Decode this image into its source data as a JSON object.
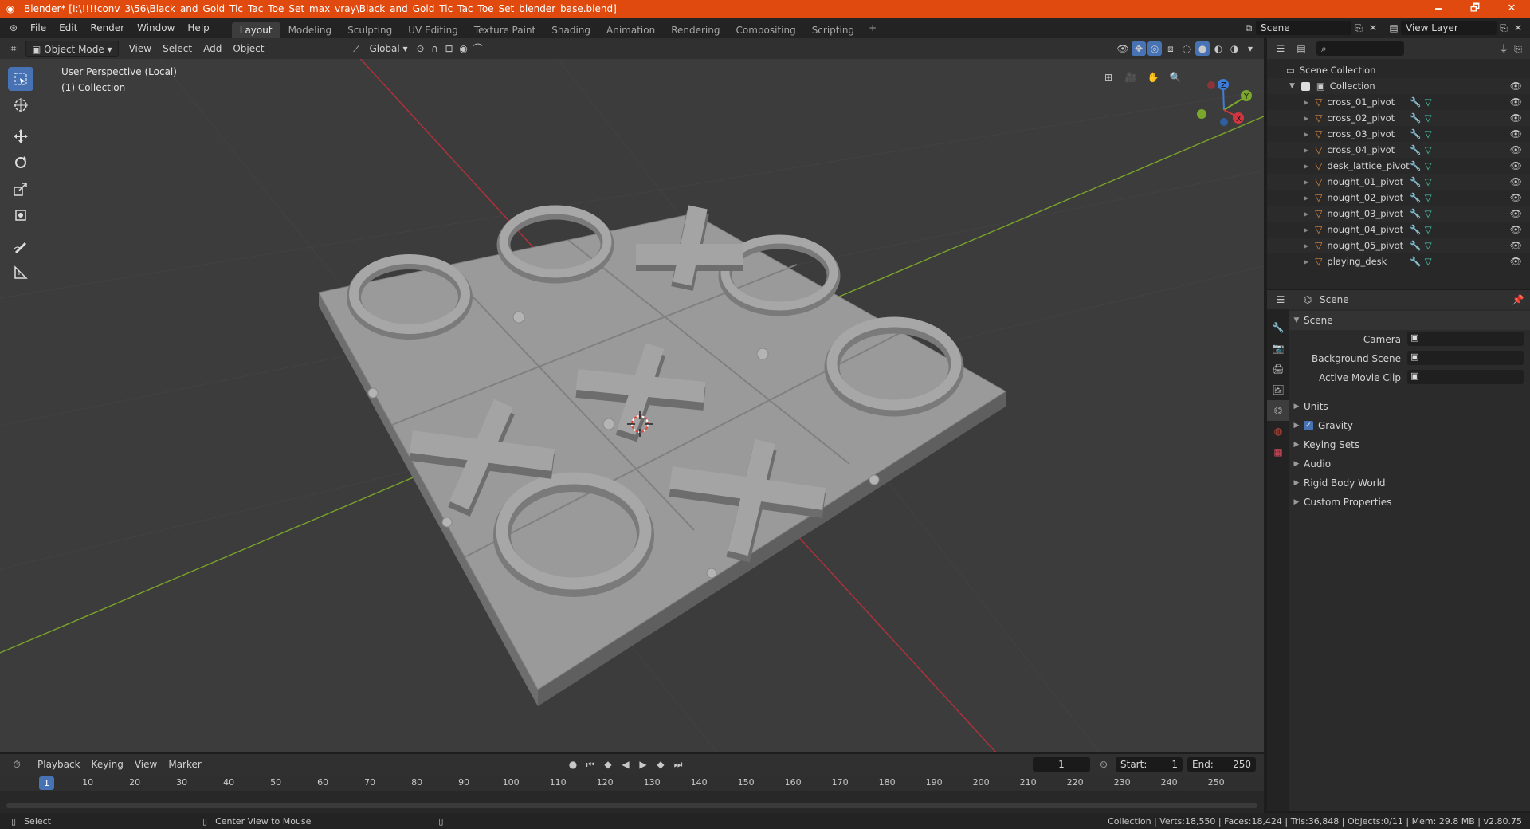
{
  "window": {
    "title": "Blender* [I:\\!!!!conv_3\\56\\Black_and_Gold_Tic_Tac_Toe_Set_max_vray\\Black_and_Gold_Tic_Tac_Toe_Set_blender_base.blend]",
    "minimize": "🗕",
    "maximize": "🗗",
    "close": "✕"
  },
  "menu": [
    "File",
    "Edit",
    "Render",
    "Window",
    "Help"
  ],
  "workspaces": [
    "Layout",
    "Modeling",
    "Sculpting",
    "UV Editing",
    "Texture Paint",
    "Shading",
    "Animation",
    "Rendering",
    "Compositing",
    "Scripting"
  ],
  "active_workspace": "Layout",
  "add_workspace": "+",
  "scene_field": "Scene",
  "view_layer_field": "View Layer",
  "viewport_header": {
    "mode": "Object Mode",
    "menus": [
      "View",
      "Select",
      "Add",
      "Object"
    ],
    "orientation": "Global"
  },
  "viewport": {
    "perspective_label": "User Perspective (Local)",
    "collection_label": "(1) Collection",
    "gizmo_axes": {
      "x": "X",
      "y": "Y",
      "z": "Z"
    },
    "colors": {
      "background": "#3c3c3c",
      "x_axis": "#b5303a",
      "y_axis": "#7aa32a",
      "board": "#9a9a9a"
    }
  },
  "outliner": {
    "root": "Scene Collection",
    "collection": "Collection",
    "items": [
      "cross_01_pivot",
      "cross_02_pivot",
      "cross_03_pivot",
      "cross_04_pivot",
      "desk_lattice_pivot",
      "nought_01_pivot",
      "nought_02_pivot",
      "nought_03_pivot",
      "nought_04_pivot",
      "nought_05_pivot",
      "playing_desk"
    ]
  },
  "properties": {
    "header": "Scene",
    "section": "Scene",
    "fields": [
      {
        "label": "Camera",
        "value": ""
      },
      {
        "label": "Background Scene",
        "value": ""
      },
      {
        "label": "Active Movie Clip",
        "value": ""
      }
    ],
    "panels": [
      {
        "label": "Units",
        "checkbox": false
      },
      {
        "label": "Gravity",
        "checkbox": true
      },
      {
        "label": "Keying Sets",
        "checkbox": false
      },
      {
        "label": "Audio",
        "checkbox": false
      },
      {
        "label": "Rigid Body World",
        "checkbox": false
      },
      {
        "label": "Custom Properties",
        "checkbox": false
      }
    ]
  },
  "timeline": {
    "menus": [
      "Playback",
      "Keying",
      "View",
      "Marker"
    ],
    "current_frame": "1",
    "start_label": "Start:",
    "start": "1",
    "end_label": "End:",
    "end": "250",
    "ticks": [
      "10",
      "20",
      "30",
      "40",
      "50",
      "60",
      "70",
      "80",
      "90",
      "100",
      "110",
      "120",
      "130",
      "140",
      "150",
      "160",
      "170",
      "180",
      "190",
      "200",
      "210",
      "220",
      "230",
      "240",
      "250"
    ],
    "frame_indicator": "1"
  },
  "statusbar": {
    "left": "Select",
    "middle": "Center View to Mouse",
    "right": "Collection | Verts:18,550 | Faces:18,424 | Tris:36,848 | Objects:0/11 | Mem: 29.8 MB | v2.80.75"
  }
}
